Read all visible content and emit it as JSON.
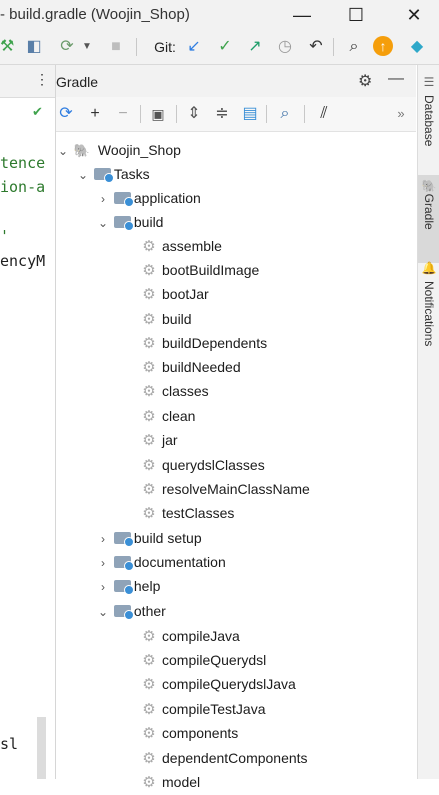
{
  "window": {
    "title": "- build.gradle (Woojin_Shop)",
    "minimize": "—",
    "maximize": "☐",
    "close": "✕"
  },
  "toolbar": {
    "git_label": "Git:",
    "colors": {
      "update": "#2f7de1",
      "commit": "#3fa34d",
      "push": "#1e9e6a",
      "history": "#9a9a9a",
      "vcs_badge": "#f59e0b"
    }
  },
  "editor": {
    "lines": [
      "tence",
      "ion-a",
      "'",
      "encyM",
      "sl"
    ]
  },
  "gradle": {
    "title": "Gradle",
    "more": "»",
    "tree": {
      "root": "Woojin_Shop",
      "tasks": "Tasks",
      "application": "application",
      "build": "build",
      "build_tasks": [
        "assemble",
        "bootBuildImage",
        "bootJar",
        "build",
        "buildDependents",
        "buildNeeded",
        "classes",
        "clean",
        "jar",
        "querydslClasses",
        "resolveMainClassName",
        "testClasses"
      ],
      "groups": [
        "build setup",
        "documentation",
        "help"
      ],
      "other": "other",
      "other_tasks": [
        "compileJava",
        "compileQuerydsl",
        "compileQuerydslJava",
        "compileTestJava",
        "components",
        "dependentComponents",
        "model"
      ]
    }
  },
  "side_tabs": {
    "database": "Database",
    "gradle": "Gradle",
    "notifications": "Notifications"
  }
}
